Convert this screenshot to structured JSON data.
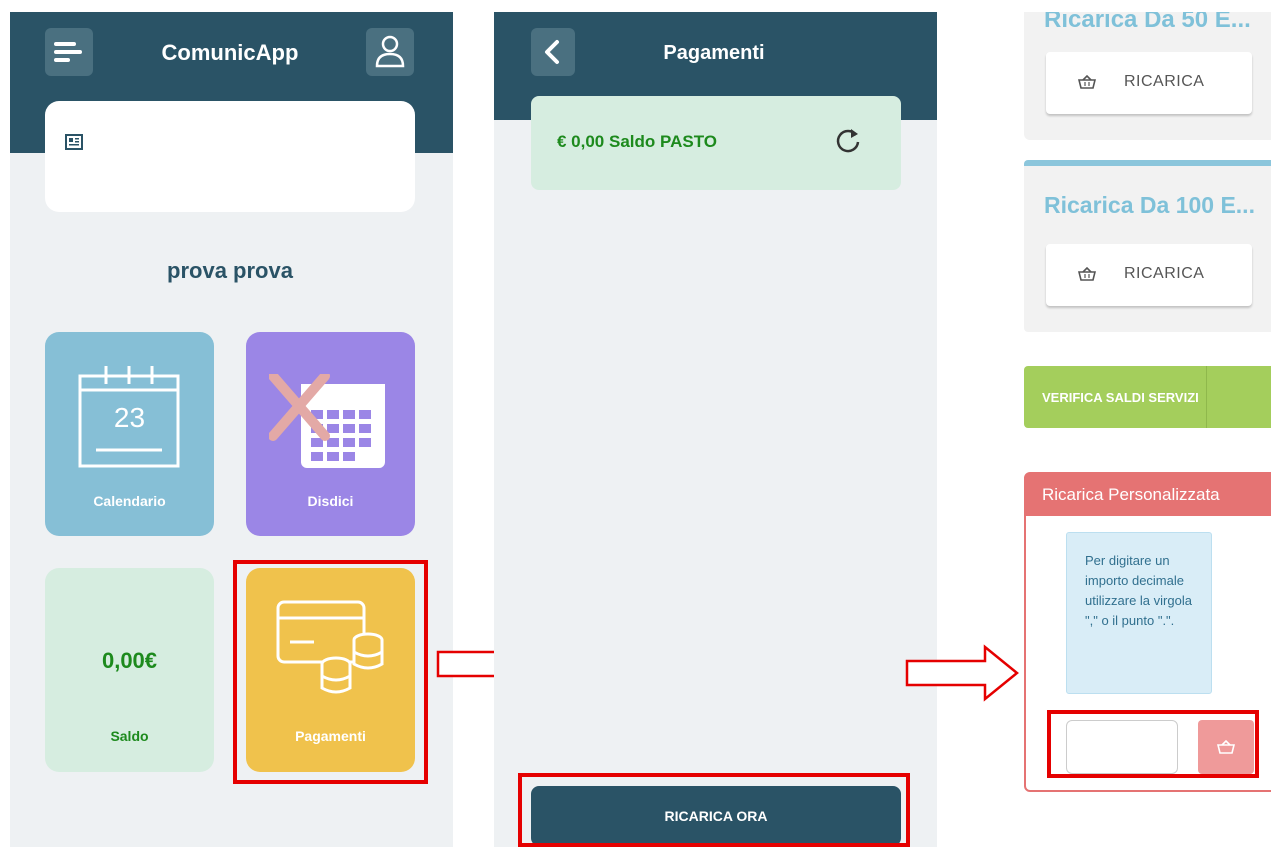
{
  "panel1": {
    "app_title": "ComunicApp",
    "user_name": "prova prova",
    "tiles": {
      "calendar": {
        "label": "Calendario",
        "day": "23"
      },
      "cancel": {
        "label": "Disdici"
      },
      "balance": {
        "amount": "0,00€",
        "label": "Saldo"
      },
      "payments": {
        "label": "Pagamenti"
      }
    }
  },
  "panel2": {
    "title": "Pagamenti",
    "balance_text": "€ 0,00 Saldo PASTO",
    "recharge_button": "RICARICA ORA"
  },
  "panel3": {
    "cut_title": "Ricarica Da 50 E...",
    "recharge_label": "RICARICA",
    "card2_title": "Ricarica Da 100 E...",
    "verify_button": "VERIFICA SALDI SERVIZI",
    "custom_title": "Ricarica Personalizzata",
    "info_text": "Per digitare un importo decimale utilizzare la virgola \",\" o il punto \".\".",
    "amount_value": ""
  },
  "colors": {
    "primary": "#2a5366",
    "highlight": "#e50000",
    "saldo_green": "#1d8a1d",
    "payments_yellow": "#f0c24c",
    "calendar_blue": "#86bfd6",
    "disdici_purple": "#9b86e6",
    "verify_green": "#a4ce5c",
    "custom_red": "#e57373"
  },
  "icons": [
    "menu-icon",
    "user-icon",
    "news-icon",
    "calendar-icon",
    "calendar-cancel-icon",
    "card-coins-icon",
    "back-icon",
    "refresh-icon",
    "basket-icon",
    "right-arrow-icon"
  ]
}
